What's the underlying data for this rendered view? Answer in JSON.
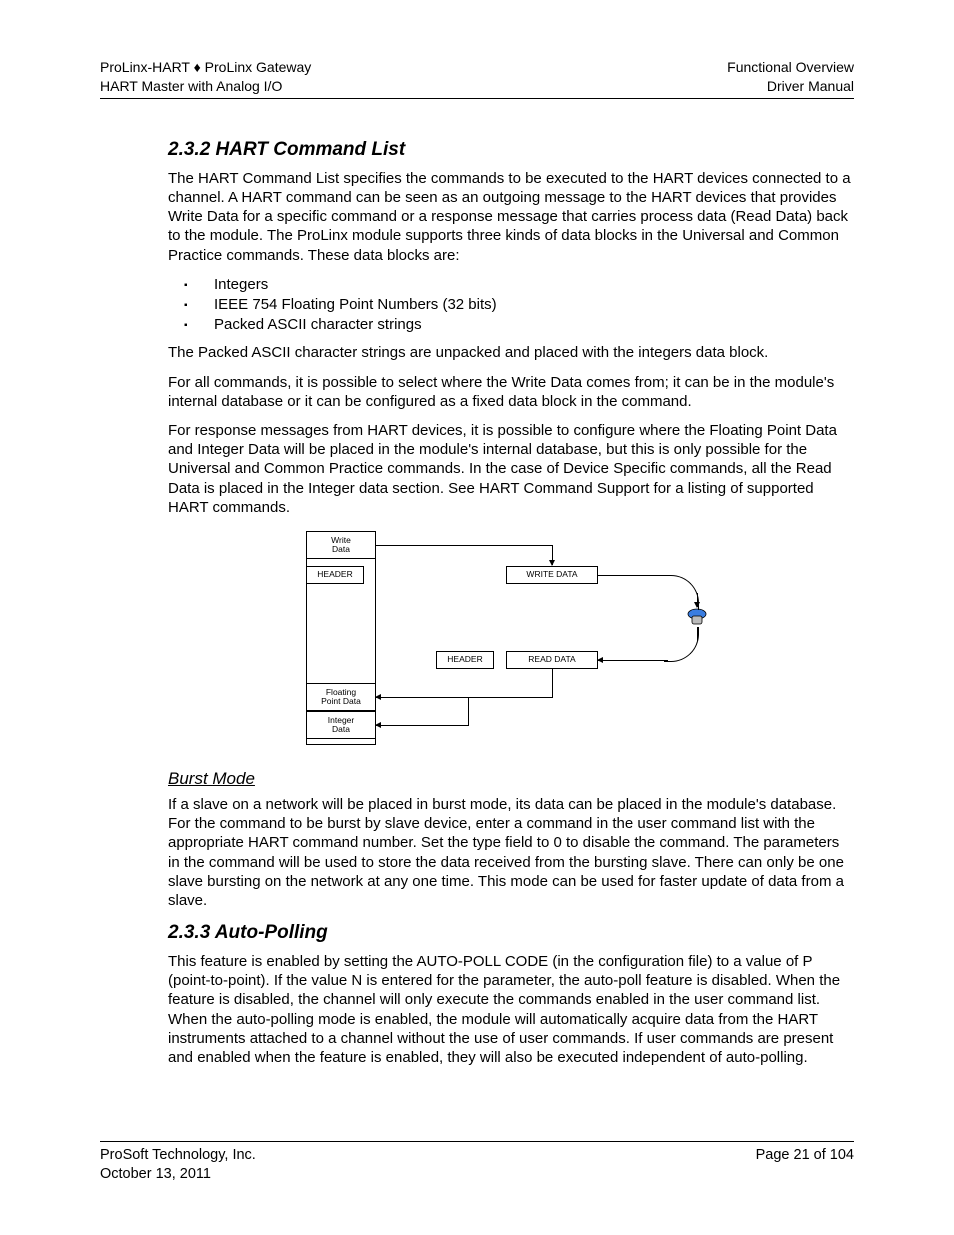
{
  "header": {
    "left1": "ProLinx-HART ♦ ProLinx Gateway",
    "left2": "HART Master with Analog I/O",
    "right1": "Functional Overview",
    "right2": "Driver Manual"
  },
  "s232": {
    "title": "2.3.2   HART Command List",
    "p1": "The HART Command List specifies the commands to be executed to the HART devices connected to a channel. A HART command can be seen as an outgoing message to the HART devices that provides Write Data for a specific command or a response message that carries process data (Read Data) back to the module. The ProLinx module supports three kinds of data blocks in the Universal and Common Practice commands. These data blocks are:",
    "bullets": [
      "Integers",
      "IEEE 754 Floating Point Numbers (32 bits)",
      "Packed ASCII character strings"
    ],
    "p2": "The Packed ASCII character strings are unpacked and placed with the integers data block.",
    "p3": "For all commands, it is possible to select where the Write Data comes from; it can be in the module's internal database or it can be configured as a fixed data block in the command.",
    "p4": "For response messages from HART devices, it is possible to configure where the Floating Point Data and Integer Data will be placed in the module's internal database, but this is only possible for the Universal and Common Practice commands. In the case of Device Specific commands, all the Read Data is placed in the Integer data section. See HART Command Support for a listing of supported HART commands."
  },
  "diagram": {
    "writeData": "Write\nData",
    "floatingPoint": "Floating\nPoint Data",
    "integerData": "Integer\nData",
    "header1": "HEADER",
    "header2": "HEADER",
    "writeDataBox": "WRITE DATA",
    "readDataBox": "READ DATA"
  },
  "burst": {
    "title": "Burst Mode",
    "p": "If a slave on a network will be placed in burst mode, its data can be placed in the module's database. For the command to be burst by slave device, enter a command in the user command list with the appropriate HART command number. Set the type field to 0 to disable the command. The parameters in the command will be used to store the data received from the bursting slave. There can only be one slave bursting on the network at any one time. This mode can be used for faster update of data from a slave."
  },
  "s233": {
    "title": "2.3.3   Auto-Polling",
    "p": "This feature is enabled by setting the AUTO-POLL CODE (in the configuration file) to a value of P (point-to-point). If the value N is entered for the parameter, the auto-poll feature is disabled. When the feature is disabled, the channel will only execute the commands enabled in the user command list. When the auto-polling mode is enabled, the module will automatically acquire data from the HART instruments attached to a channel without the use of user commands. If user commands are present and enabled when the feature is enabled, they will also be executed independent of auto-polling."
  },
  "footer": {
    "company": "ProSoft Technology, Inc.",
    "date": "October 13, 2011",
    "page": "Page 21 of 104"
  }
}
